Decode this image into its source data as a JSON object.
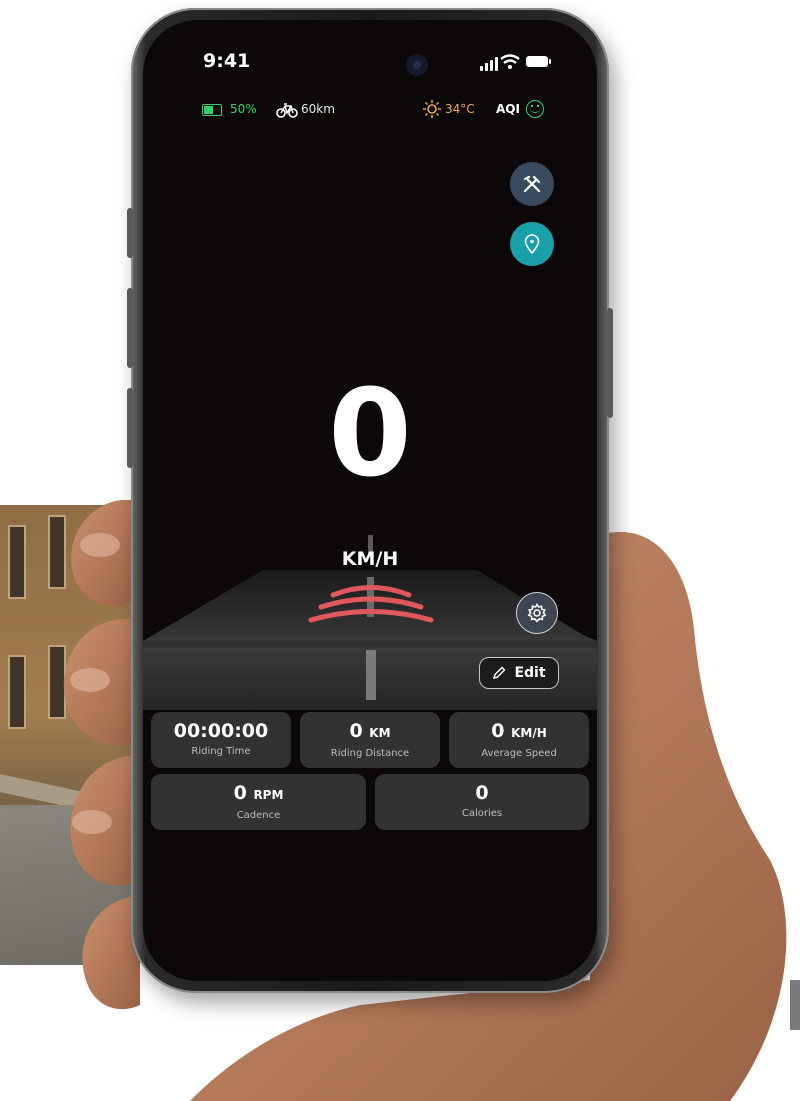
{
  "status_bar": {
    "time": "9:41"
  },
  "info_bar": {
    "battery_percent": "50%",
    "range": "60km",
    "temperature": "34°C",
    "aqi_label": "AQI"
  },
  "speedometer": {
    "speed": "0",
    "unit": "KM/H"
  },
  "edit_button": {
    "label": "Edit"
  },
  "stats": [
    {
      "value": "00:00:00",
      "unit": "",
      "label": "Riding Time"
    },
    {
      "value": "0",
      "unit": "KM",
      "label": "Riding Distance"
    },
    {
      "value": "0",
      "unit": "KM/H",
      "label": "Average Speed"
    },
    {
      "value": "0",
      "unit": "RPM",
      "label": "Cadence"
    },
    {
      "value": "0",
      "unit": "",
      "label": "Calories"
    }
  ],
  "icons": {
    "tools_button": "tools-icon",
    "navigation_button": "location-pin-icon",
    "settings_button": "gear-icon",
    "edit": "pencil-icon"
  },
  "colors": {
    "screen_bg": "#0c0809",
    "battery_green": "#2fd06a",
    "temp_orange": "#f0a94a",
    "nav_teal": "#1aa0a8",
    "radar_red": "#e0585c",
    "card_bg": "#323232"
  }
}
